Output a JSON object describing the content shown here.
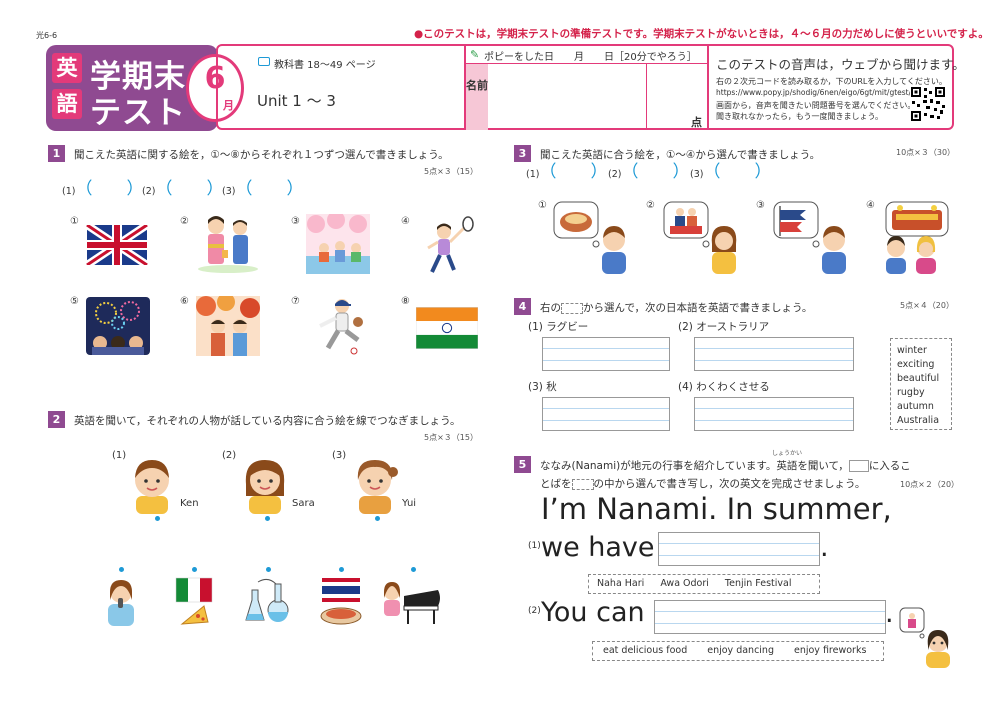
{
  "header": {
    "doc_code": "光6-6",
    "notice": "●このテストは，学期末テストの準備テストです。学期末テストがないときは，４〜６月の力だめしに使うといいですよ。",
    "badge_char1": "英",
    "badge_char2": "語",
    "badge_title1": "学期末",
    "badge_title2": "テスト",
    "month_num": "6",
    "month_unit": "月",
    "textbook_ref": "教科書 18〜49 ページ",
    "unit_title": "Unit 1 〜 3",
    "date_text": "ポピーをした日　　月　　日［20分でやろう］",
    "name_label": "名前",
    "score_label": "点",
    "audio_title": "このテストの音声は，ウェブから聞けます。",
    "audio_line1": "右の２次元コードを読み取るか，下のURLを入力してください。",
    "audio_url": "https://www.popy.jp/shodig/6nen/eigo/6gt/mit/gtest/",
    "audio_line3": "画面から，音声を聞きたい問題番号を選んでください。",
    "audio_line4": "聞き取れなかったら，もう一度聞きましょう。"
  },
  "q1": {
    "num": "1",
    "text": "聞こえた英語に関する絵を，①〜⑧からそれぞれ１つずつ選んで書きましょう。",
    "points": "5点×３（15）",
    "answers": [
      "(1)",
      "(2)",
      "(3)"
    ],
    "choices": [
      "①",
      "②",
      "③",
      "④",
      "⑤",
      "⑥",
      "⑦",
      "⑧"
    ]
  },
  "q2": {
    "num": "2",
    "text": "英語を聞いて，それぞれの人物が話している内容に合う絵を線でつなぎましょう。",
    "points": "5点×３（15）",
    "labels": [
      "(1)",
      "(2)",
      "(3)"
    ],
    "names": [
      "Ken",
      "Sara",
      "Yui"
    ]
  },
  "q3": {
    "num": "3",
    "text": "聞こえた英語に合う絵を，①〜④から選んで書きましょう。",
    "points": "10点×３（30）",
    "answers": [
      "(1)",
      "(2)",
      "(3)"
    ],
    "choices": [
      "①",
      "②",
      "③",
      "④"
    ]
  },
  "q4": {
    "num": "4",
    "text_a": "右の",
    "text_b": "から選んで，次の日本語を英語で書きましょう。",
    "points": "5点×４（20）",
    "items": [
      "(1) ラグビー",
      "(2) オーストラリア",
      "(3) 秋",
      "(4) わくわくさせる"
    ],
    "word_list": [
      "winter",
      "exciting",
      "beautiful",
      "rugby",
      "autumn",
      "Australia"
    ]
  },
  "q5": {
    "num": "5",
    "ruby": "しょうかい",
    "text_line1": "ななみ(Nanami)が地元の行事を紹介しています。英語を聞いて，",
    "text_line1b": "に入るこ",
    "text_line2a": "とばを",
    "text_line2b": "の中から選んで書き写し，次の英文を完成させましょう。",
    "points": "10点×２（20）",
    "sentence_main": "I’m Nanami.  In summer,",
    "label1": "(1)",
    "sentence1": "we have",
    "period1": ".",
    "options1": [
      "Naha Hari",
      "Awa Odori",
      "Tenjin Festival"
    ],
    "label2": "(2)",
    "sentence2": "You can",
    "period2": ".",
    "options2": [
      "eat delicious food",
      "enjoy dancing",
      "enjoy fireworks"
    ]
  }
}
